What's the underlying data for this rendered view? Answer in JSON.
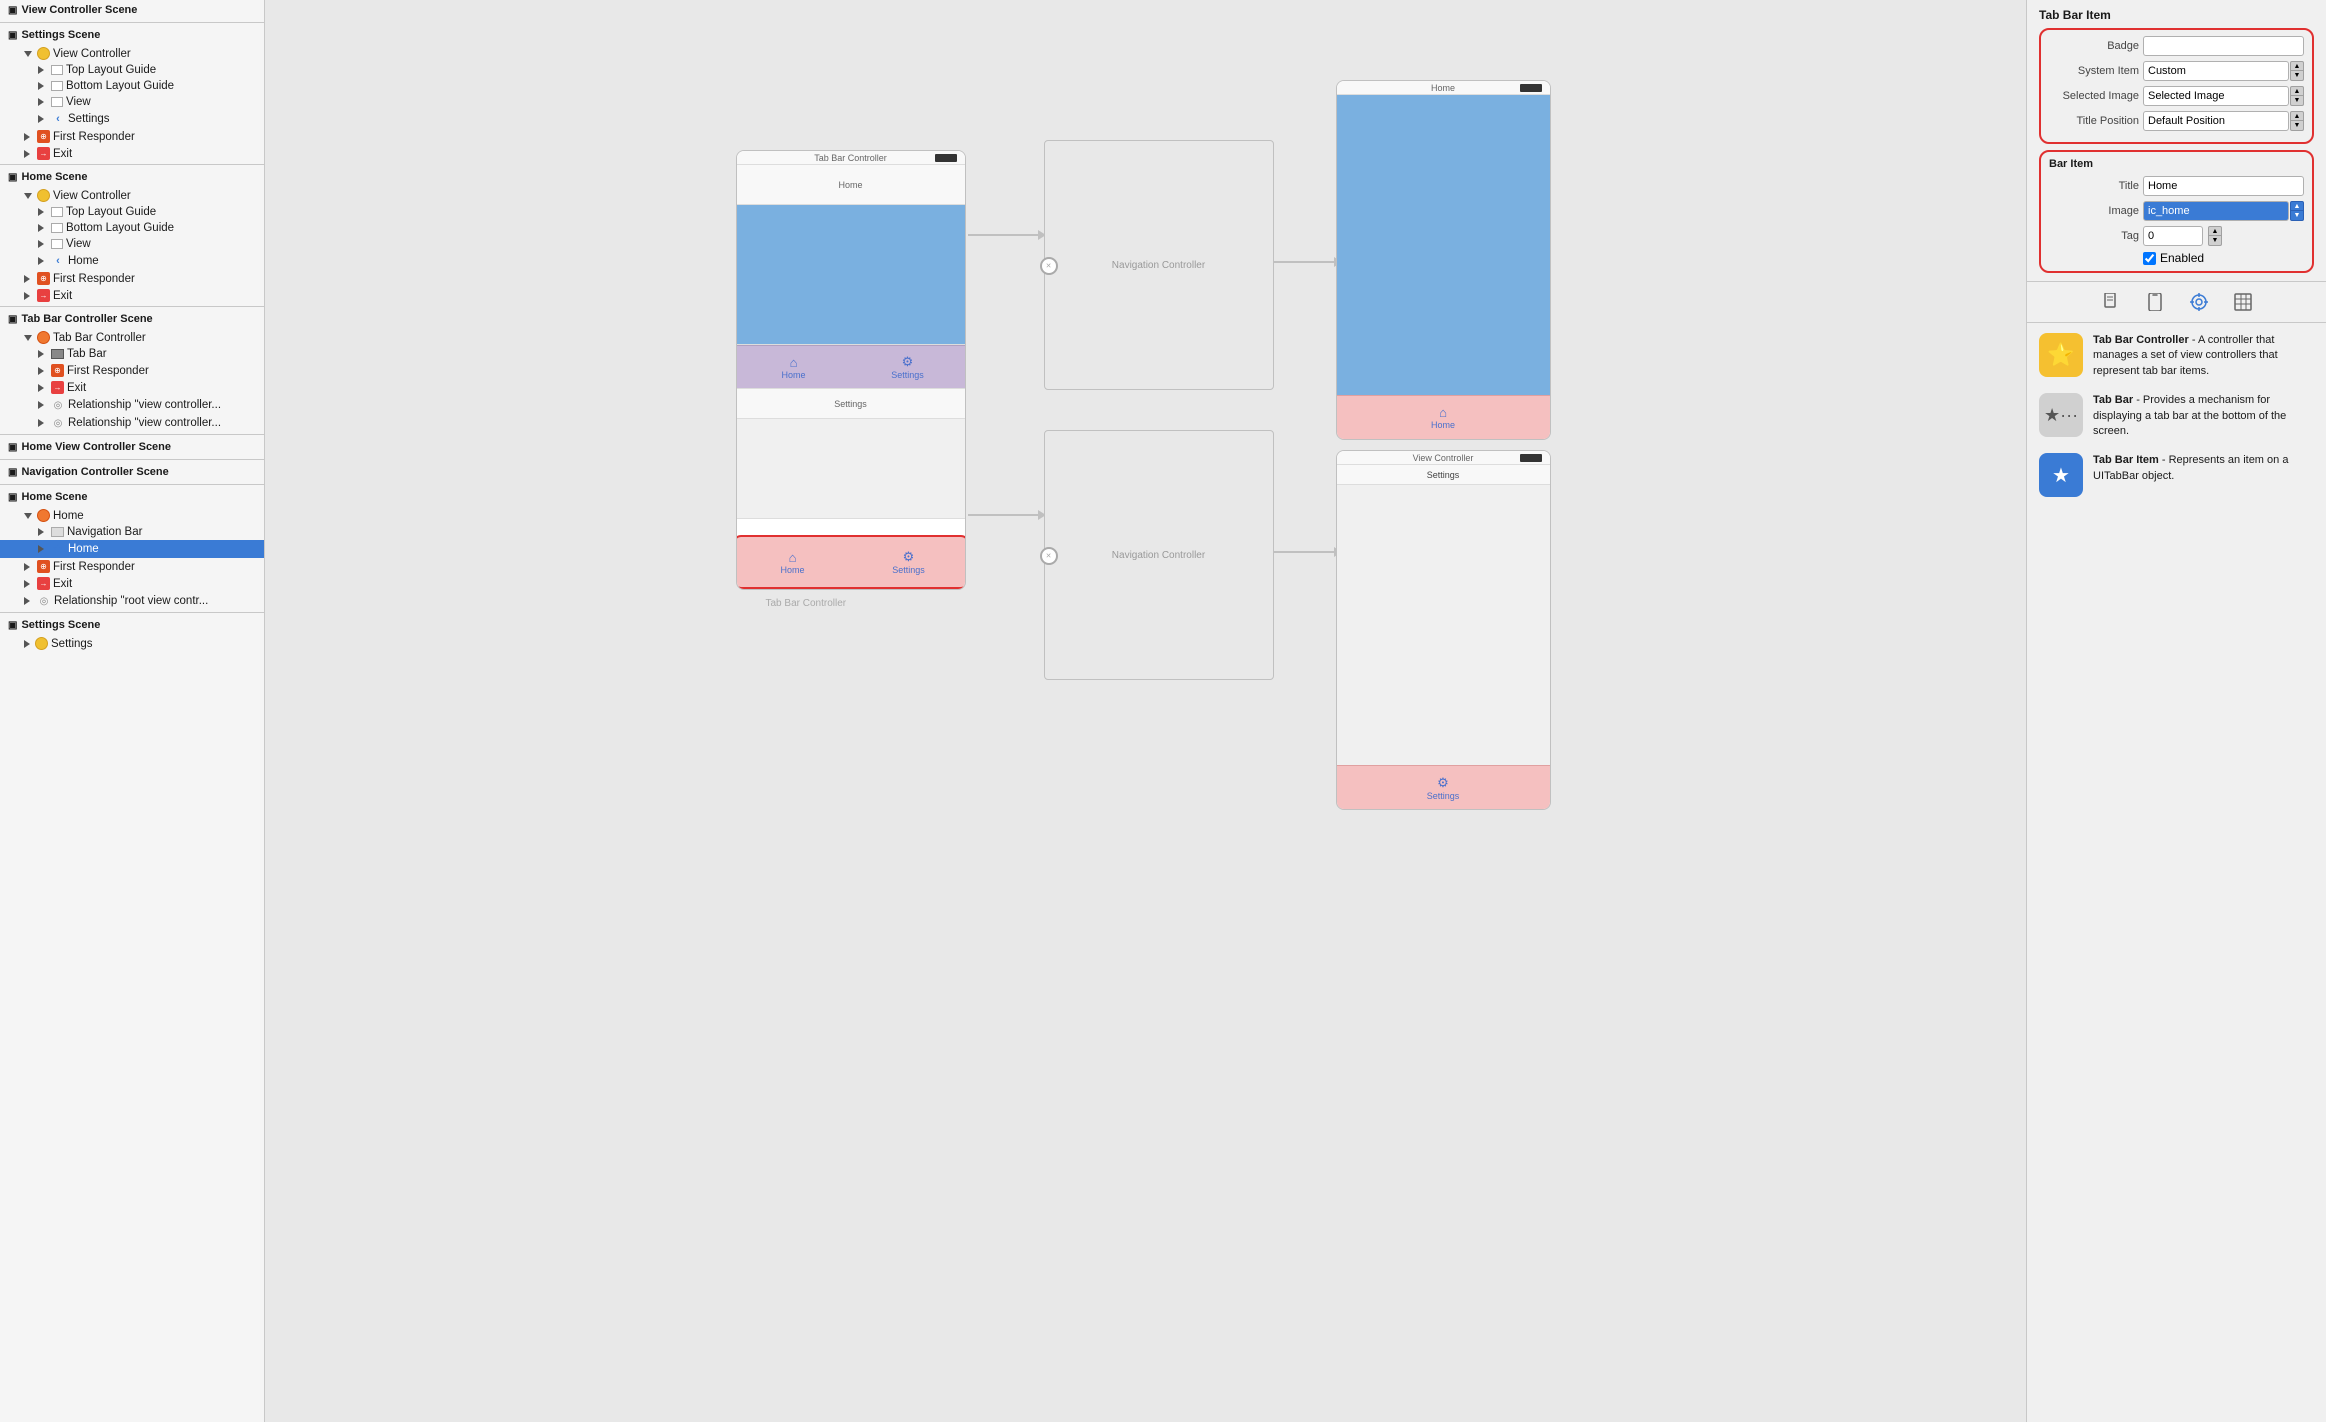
{
  "left_panel": {
    "scenes": [
      {
        "name": "View Controller Scene",
        "icon": "scene",
        "children": []
      },
      {
        "name": "Settings Scene",
        "icon": "scene",
        "children": [
          {
            "label": "View Controller",
            "icon": "yellow-circle",
            "indent": 1,
            "expanded": true,
            "children": [
              {
                "label": "Top Layout Guide",
                "icon": "rect-white",
                "indent": 2
              },
              {
                "label": "Bottom Layout Guide",
                "icon": "rect-white",
                "indent": 2
              },
              {
                "label": "View",
                "icon": "rect-white",
                "indent": 2
              },
              {
                "label": "Settings",
                "icon": "chevron-left",
                "indent": 2
              }
            ]
          },
          {
            "label": "First Responder",
            "icon": "first-responder",
            "indent": 1
          },
          {
            "label": "Exit",
            "icon": "exit-icon",
            "indent": 1
          }
        ]
      },
      {
        "name": "Home Scene",
        "icon": "scene",
        "children": [
          {
            "label": "View Controller",
            "icon": "yellow-circle",
            "indent": 1,
            "expanded": true,
            "children": [
              {
                "label": "Top Layout Guide",
                "icon": "rect-white",
                "indent": 2
              },
              {
                "label": "Bottom Layout Guide",
                "icon": "rect-white",
                "indent": 2
              },
              {
                "label": "View",
                "icon": "rect-white",
                "indent": 2
              },
              {
                "label": "Home",
                "icon": "chevron-left",
                "indent": 2
              }
            ]
          },
          {
            "label": "First Responder",
            "icon": "first-responder",
            "indent": 1
          },
          {
            "label": "Exit",
            "icon": "exit-icon",
            "indent": 1
          }
        ]
      },
      {
        "name": "Tab Bar Controller Scene",
        "icon": "scene",
        "children": [
          {
            "label": "Tab Bar Controller",
            "icon": "orange-circle",
            "indent": 1,
            "expanded": true,
            "children": [
              {
                "label": "Tab Bar",
                "icon": "tab-bar-item",
                "indent": 2
              },
              {
                "label": "First Responder",
                "icon": "first-responder",
                "indent": 2
              },
              {
                "label": "Exit",
                "icon": "exit-icon",
                "indent": 2
              },
              {
                "label": "Relationship \"view controller...",
                "icon": "circle-arrow",
                "indent": 2
              },
              {
                "label": "Relationship \"view controller...",
                "icon": "circle-arrow",
                "indent": 2
              }
            ]
          }
        ]
      },
      {
        "name": "Home View Controller Scene",
        "icon": "scene",
        "children": []
      },
      {
        "name": "Navigation Controller Scene",
        "icon": "scene",
        "children": []
      },
      {
        "name": "Home Scene",
        "icon": "scene",
        "children": [
          {
            "label": "Home",
            "icon": "orange-circle",
            "indent": 1,
            "expanded": true,
            "children": [
              {
                "label": "Navigation Bar",
                "icon": "nav-bar-icon",
                "indent": 2
              },
              {
                "label": "Home",
                "icon": "star",
                "indent": 2,
                "selected": true
              }
            ]
          },
          {
            "label": "First Responder",
            "icon": "first-responder",
            "indent": 1
          },
          {
            "label": "Exit",
            "icon": "exit-icon",
            "indent": 1
          },
          {
            "label": "Relationship \"root view contr...",
            "icon": "circle-arrow",
            "indent": 1
          }
        ]
      },
      {
        "name": "Settings Scene",
        "icon": "scene",
        "children": [
          {
            "label": "Settings",
            "icon": "yellow-circle",
            "indent": 1,
            "expanded": false
          }
        ]
      }
    ]
  },
  "right_panel": {
    "title": "Tab Bar Item",
    "sections": {
      "tab_bar_item": {
        "title": "Tab Bar Item",
        "badge_label": "Badge",
        "badge_value": "",
        "system_item_label": "System Item",
        "system_item_value": "Custom",
        "selected_image_label": "Selected Image",
        "selected_image_value": "Selected Image",
        "title_position_label": "Title Position",
        "title_position_value": "Default Position"
      },
      "bar_item": {
        "title": "Bar Item",
        "title_label": "Title",
        "title_value": "Home",
        "image_label": "Image",
        "image_value": "ic_home",
        "tag_label": "Tag",
        "tag_value": "0",
        "enabled_label": "Enabled",
        "enabled_checked": true
      }
    },
    "toolbar_icons": [
      "doc",
      "phone",
      "circle-target",
      "table"
    ],
    "descriptions": [
      {
        "icon": "⭐",
        "bg": "yellow-bg",
        "title": "Tab Bar Controller",
        "text": "A controller that manages a set of view controllers that represent tab bar items."
      },
      {
        "icon": "★",
        "bg": "gray-bg",
        "title": "Tab Bar",
        "text": "Provides a mechanism for displaying a tab bar at the bottom of the screen."
      },
      {
        "icon": "★",
        "bg": "blue-bg",
        "title": "Tab Bar Item",
        "text": "Represents an item on a UITabBar object."
      }
    ]
  },
  "canvas": {
    "tab_bar_controller_label": "Tab Bar Controller",
    "navigation_controller_label": "Navigation Controller",
    "home_title": "Home",
    "settings_title": "Settings",
    "view_controller_label": "View Controller",
    "tab_bar_controller_box_label": "Tab Bar Controller",
    "home_tab_label": "Home",
    "settings_tab_label": "Settings"
  }
}
